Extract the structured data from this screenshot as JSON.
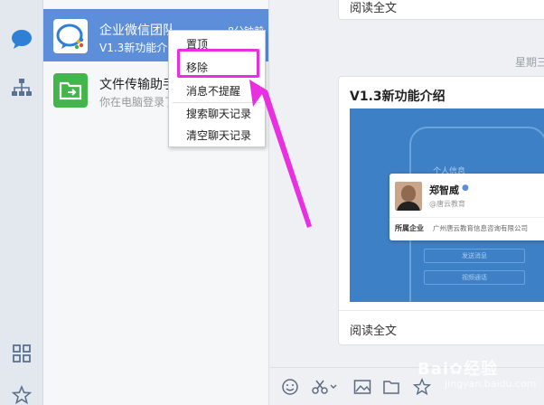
{
  "rail": {
    "icons": [
      "chat-bubble-icon",
      "org-chart-icon",
      "apps-grid-icon",
      "star-icon"
    ],
    "accent": "#2e7fd6"
  },
  "conversations": [
    {
      "name": "企业微信团队",
      "preview": "V1.3新功能介",
      "time": "8分钟前",
      "selected": true,
      "icon": "wecom-logo-icon"
    },
    {
      "name": "文件传输助手",
      "preview": "你在电脑登录了",
      "time": "",
      "selected": false,
      "icon": "file-transfer-icon"
    }
  ],
  "context_menu": {
    "items": [
      "置顶",
      "移除",
      "消息不提醒",
      "搜索聊天记录",
      "清空聊天记录"
    ],
    "highlighted": "移除",
    "highlight_color": "#e830e0"
  },
  "chat": {
    "previous_card_link": "阅读全文",
    "day_label": "星期三",
    "card": {
      "title": "V1.3新功能介绍",
      "image": {
        "screen_title": "个人信息",
        "profile_name": "郑智威",
        "profile_org": "@唐云教育",
        "company_label": "所属企业",
        "company_value": "广州唐云教育信息咨询有限公司",
        "button_1": "发送消息",
        "button_2": "视频通话"
      },
      "read_more": "阅读全文"
    },
    "toolbar_icons": [
      "emoji-icon",
      "scissors-icon",
      "image-icon",
      "folder-icon",
      "star-icon"
    ]
  },
  "watermark": {
    "brand": "Bai",
    "suffix": "经验",
    "url": "jingyan.baidu.com"
  }
}
